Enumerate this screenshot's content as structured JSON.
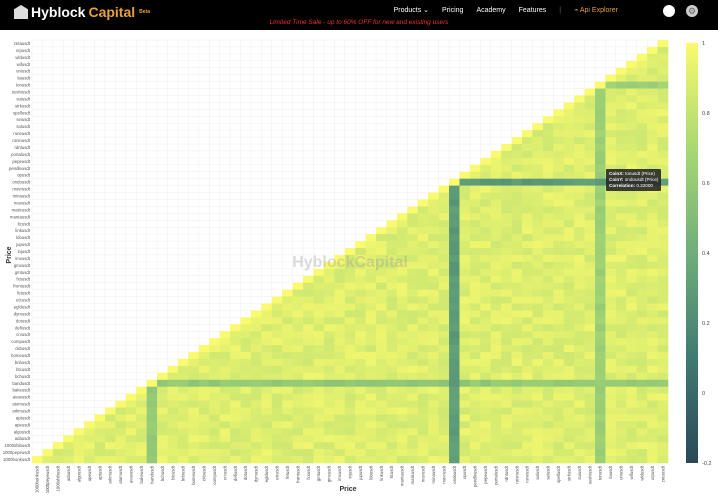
{
  "nav": {
    "brand_a": "Hyblock",
    "brand_b": "Capital",
    "brand_badge": "Beta",
    "items": [
      "Products ⌄",
      "Pricing",
      "Academy",
      "Features"
    ],
    "api_label": "Api Explorer",
    "promo": "Limited Time Sale - up to 60% OFF for new and existing users"
  },
  "tooltip": {
    "coinx_label": "CoinX:",
    "coinx": "tonusdt (Price)",
    "coiny_label": "CoinY:",
    "coiny": "ondousdt (Price)",
    "corr_label": "Correlation:",
    "corr": "0.32000"
  },
  "chart_data": {
    "type": "heatmap",
    "xlabel": "Price",
    "ylabel": "Price",
    "watermark": "HyblockCapital",
    "labels_top_to_bottom": [
      "zetausdt",
      "xrpusdt",
      "wldusdt",
      "wifusdt",
      "uniusdt",
      "tiausdt",
      "tonusdt",
      "sushiusdt",
      "suiusdt",
      "strkusdt",
      "spellusdt",
      "seiusdt",
      "solusdt",
      "runeusdt",
      "roninusdt",
      "rdntusdt",
      "portalusdt",
      "pepeusdt",
      "pendleusdt",
      "opusdt",
      "ondousdt",
      "movrusdt",
      "minausdt",
      "mavusdt",
      "maticusdt",
      "mantausdt",
      "ltcusdt",
      "linkusdt",
      "ldousdt",
      "jupusdt",
      "injusdt",
      "imxusdt",
      "gmxusdt",
      "gmtusdt",
      "fxsusdt",
      "frontusdt",
      "fetusdt",
      "etcusdt",
      "egldusdt",
      "dymusdt",
      "dotusdt",
      "defiusdt",
      "crvusdt",
      "compusdt",
      "ckbusdt",
      "bomeusdt",
      "bnbusdt",
      "btcusdt",
      "bchusdt",
      "bandusdt",
      "bakeusdt",
      "avaxusdt",
      "atomusdt",
      "arkmusdt",
      "aptusdt",
      "apeusdt",
      "algousdt",
      "adausdt",
      "1000shibusdt",
      "1000pepeusdt",
      "1000bonkusdt"
    ],
    "triangle": "lower",
    "typical_correlation": 0.9,
    "low_correlation_coins": {
      "ondousdt": 0.25,
      "tonusdt": 0.6,
      "bandusdt": 0.55
    },
    "colorscale": [
      "#2a4858",
      "#3f7a72",
      "#6fae7b",
      "#a8d873",
      "#fafa6e"
    ],
    "zlim": [
      -0.2,
      1
    ],
    "colorbar_ticks": [
      "1",
      "0.8",
      "0.6",
      "0.4",
      "0.2",
      "0",
      "-0.2"
    ],
    "grid": true
  }
}
